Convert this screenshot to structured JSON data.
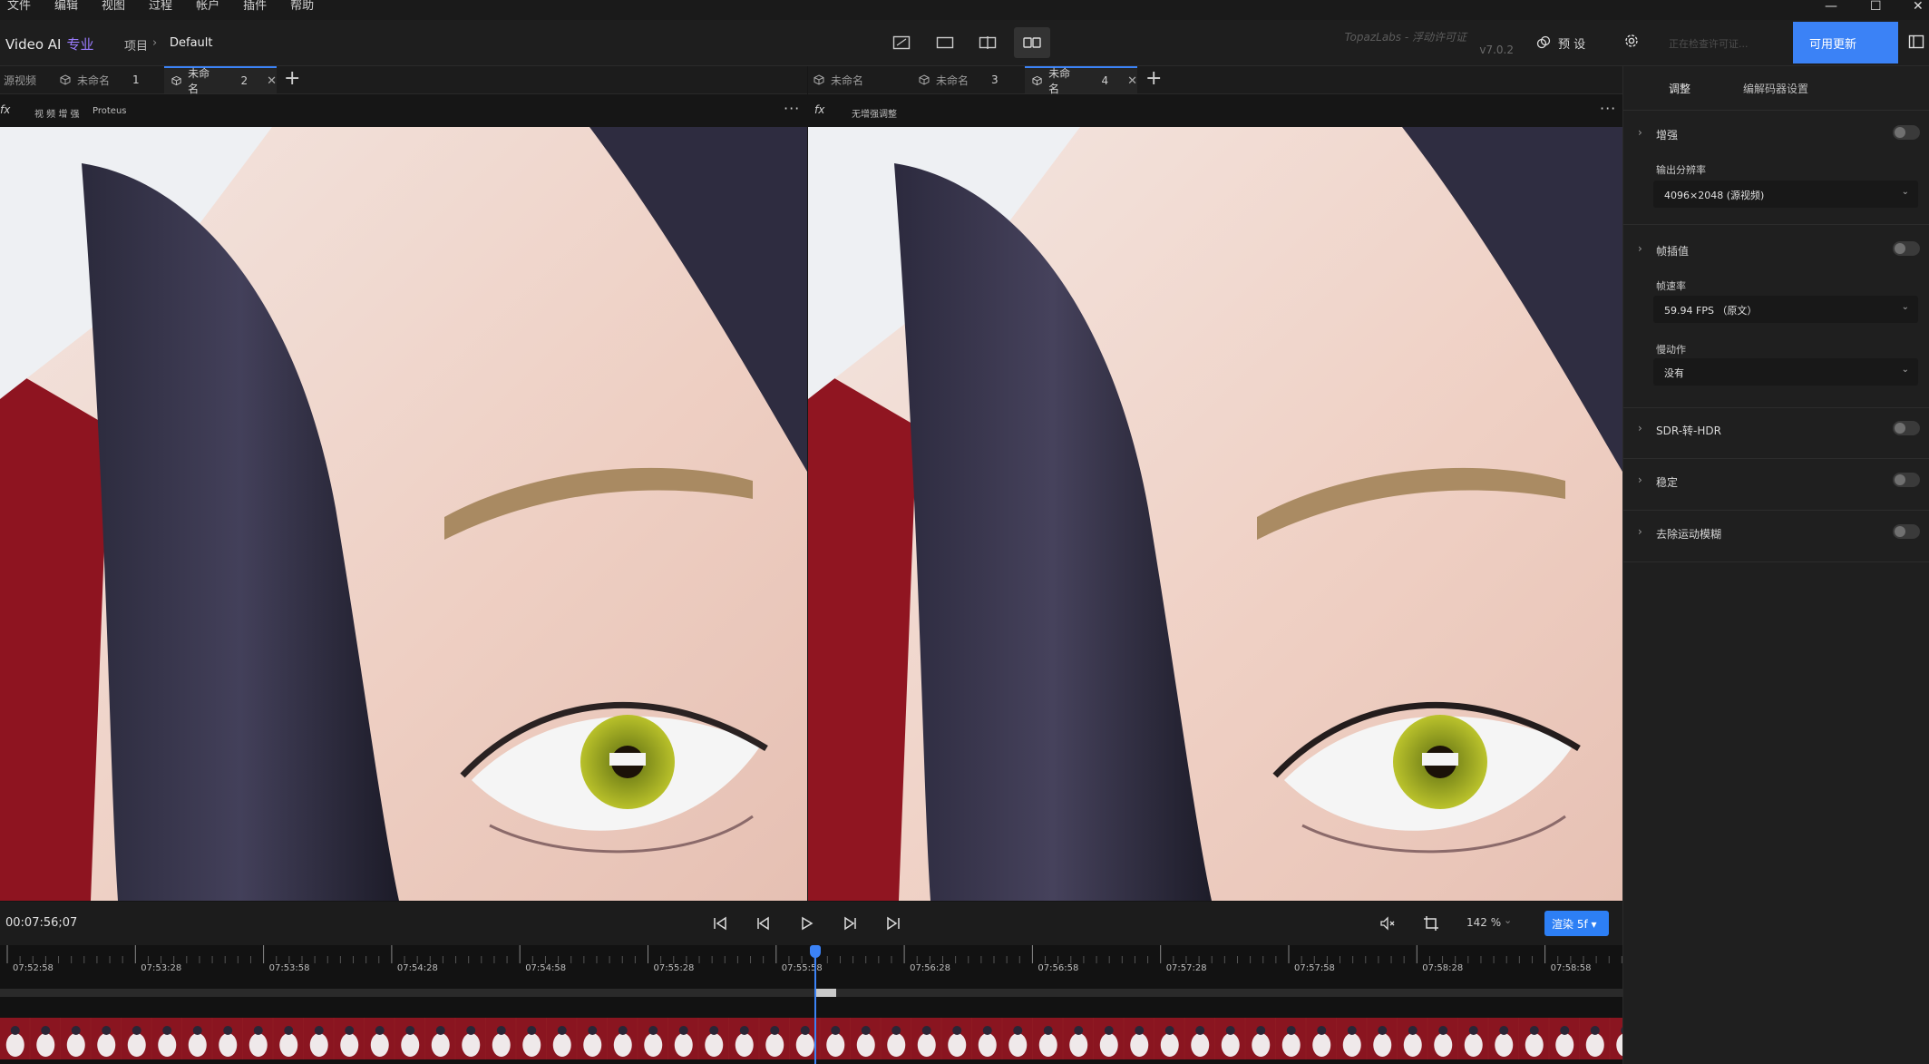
{
  "menu": [
    "文件",
    "编辑",
    "视图",
    "过程",
    "帐户",
    "插件",
    "帮助"
  ],
  "window_controls": {
    "minimize": "—",
    "maximize": "☐",
    "close": "✕"
  },
  "toolbar": {
    "app_name": "Video AI",
    "app_tier": "专业",
    "breadcrumb_root": "项目",
    "breadcrumb_sep": "›",
    "breadcrumb_current": "Default",
    "watermark": "TopazLabs - 浮动许可证",
    "version": "v7.0.2",
    "preset_label": "预 设",
    "license_status": "正在检查许可证...",
    "update_button": "可用更新"
  },
  "left_tabs": [
    {
      "label": "源视频",
      "num": ""
    },
    {
      "label": "未命名",
      "num": "1"
    },
    {
      "label": "未命名",
      "num": "2"
    }
  ],
  "right_tabs": [
    {
      "label": "未命名",
      "num": ""
    },
    {
      "label": "未命名",
      "num": "3"
    },
    {
      "label": "未命名",
      "num": "4"
    }
  ],
  "tab_close": "✕",
  "tab_add": "+",
  "left_sub": {
    "fx": "fx",
    "label": "视 频 增 强",
    "model": "Proteus"
  },
  "right_sub": {
    "fx": "fx",
    "label": "无增强调整"
  },
  "more_menu": "···",
  "transport": {
    "timecode": "00:07:56;07",
    "zoom": "142 %",
    "zoom_chevron": "⌄",
    "render_button": "渲染 5f ▾"
  },
  "timeline": {
    "ticks": [
      "07:52:58",
      "07:53:28",
      "07:53:58",
      "07:54:28",
      "07:54:58",
      "07:55:28",
      "07:55:58",
      "07:56:28",
      "07:56:58",
      "07:57:28",
      "07:57:58",
      "07:58:28",
      "07:58:58"
    ],
    "playhead_fraction": 0.502
  },
  "right_panel": {
    "tab_adjust": "调整",
    "tab_codec": "编解码器设置",
    "sections": {
      "enhance": "增强",
      "output_res_label": "输出分辨率",
      "output_res_value": "4096×2048 (源视频)",
      "frame_interp": "帧插值",
      "framerate_label": "帧速率",
      "framerate_value": "59.94 FPS （原文）",
      "slowmo_label": "慢动作",
      "slowmo_value": "没有",
      "sdr_hdr": "SDR-转-HDR",
      "stabilize": "稳定",
      "motion_deblur": "去除运动模糊"
    },
    "chevron": "›",
    "select_arrow": "⌄"
  },
  "colors": {
    "accent": "#3b82f6",
    "pro": "#9b7cff",
    "background": "#161616"
  }
}
